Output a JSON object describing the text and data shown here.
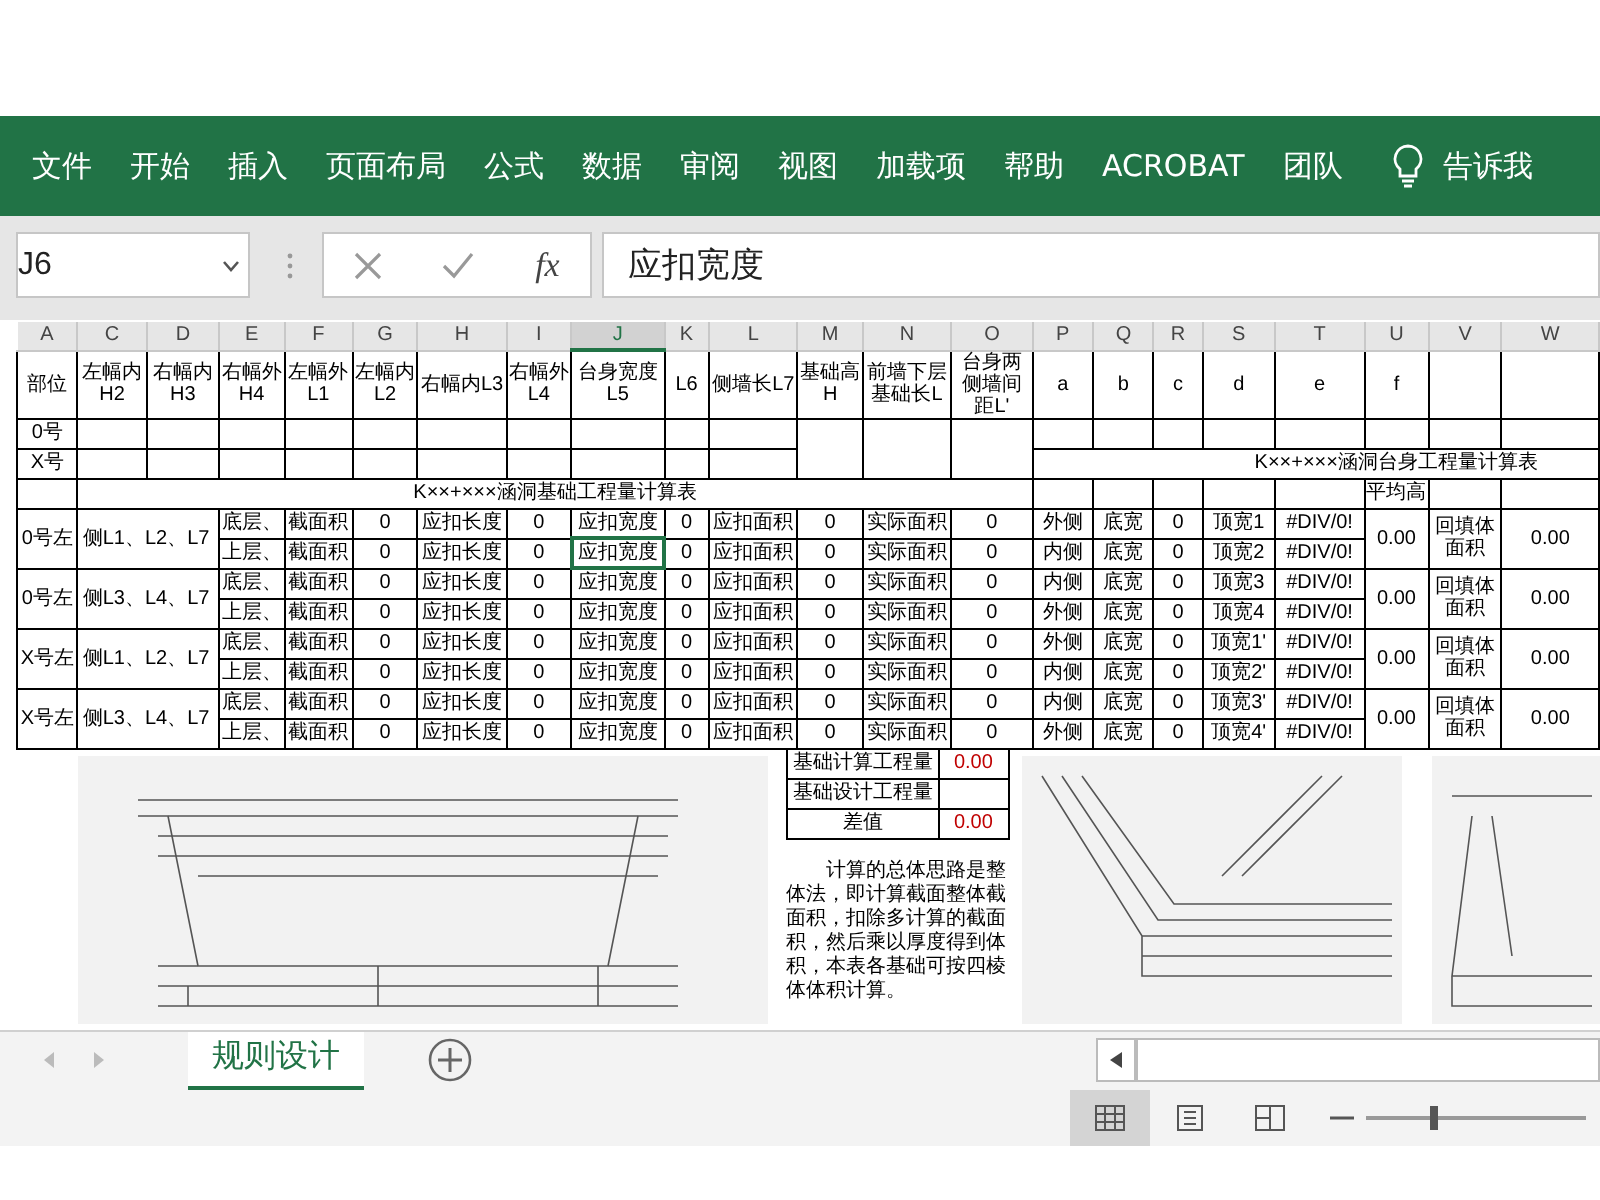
{
  "ribbon": {
    "tabs": [
      {
        "label": "文件"
      },
      {
        "label": "开始"
      },
      {
        "label": "插入"
      },
      {
        "label": "页面布局"
      },
      {
        "label": "公式"
      },
      {
        "label": "数据"
      },
      {
        "label": "审阅"
      },
      {
        "label": "视图"
      },
      {
        "label": "加载项"
      },
      {
        "label": "帮助"
      },
      {
        "label": "ACROBAT"
      },
      {
        "label": "团队"
      }
    ],
    "tell_me": "告诉我"
  },
  "formula_bar": {
    "name_box": "J6",
    "fx": "fx",
    "formula": "应扣宽度"
  },
  "sheet": {
    "columns": [
      {
        "label": "A",
        "selected": false
      },
      {
        "label": "C",
        "selected": false
      },
      {
        "label": "D",
        "selected": false
      },
      {
        "label": "E",
        "selected": false
      },
      {
        "label": "F",
        "selected": false
      },
      {
        "label": "G",
        "selected": false
      },
      {
        "label": "H",
        "selected": false
      },
      {
        "label": "I",
        "selected": false
      },
      {
        "label": "J",
        "selected": true
      },
      {
        "label": "K",
        "selected": false
      },
      {
        "label": "L",
        "selected": false
      },
      {
        "label": "M",
        "selected": false
      },
      {
        "label": "N",
        "selected": false
      },
      {
        "label": "O",
        "selected": false
      },
      {
        "label": "P",
        "selected": false
      },
      {
        "label": "Q",
        "selected": false
      },
      {
        "label": "R",
        "selected": false
      },
      {
        "label": "S",
        "selected": false
      },
      {
        "label": "T",
        "selected": false
      },
      {
        "label": "U",
        "selected": false
      },
      {
        "label": "V",
        "selected": false
      },
      {
        "label": "W",
        "selected": false
      }
    ],
    "header_row": [
      "部位",
      "左幅内H2",
      "右幅内H3",
      "右幅外H4",
      "左幅外L1",
      "左幅内L2",
      "右幅内L3",
      "右幅外L4",
      "台身宽度L5",
      "L6",
      "侧墙长L7",
      "基础高H",
      "前墙下层基础长L",
      "台身两侧墙间距L'",
      "a",
      "b",
      "c",
      "d",
      "e",
      "f"
    ],
    "label_rows": [
      "0号",
      "X号"
    ],
    "right_title": "K××+×××涵洞台身工程量计算表",
    "left_title": "K××+×××涵洞基础工程量计算表",
    "average_label": "平均高",
    "groups": [
      {
        "part": "0号左",
        "sides": "侧L1、L2、L7",
        "average": "0.00",
        "fill_label": "回填体面积",
        "total": "0.00",
        "rows": [
          {
            "layer": "底层、",
            "active": false,
            "cells": [
              "截面积",
              "0",
              "应扣长度",
              "0",
              "应扣宽度",
              "0",
              "应扣面积",
              "0",
              "实际面积",
              "0",
              "外侧",
              "底宽",
              "0",
              "顶宽1",
              "#DIV/0!"
            ]
          },
          {
            "layer": "上层、",
            "active": true,
            "cells": [
              "截面积",
              "0",
              "应扣长度",
              "0",
              "应扣宽度",
              "0",
              "应扣面积",
              "0",
              "实际面积",
              "0",
              "内侧",
              "底宽",
              "0",
              "顶宽2",
              "#DIV/0!"
            ]
          }
        ]
      },
      {
        "part": "0号左",
        "sides": "侧L3、L4、L7",
        "average": "0.00",
        "fill_label": "回填体面积",
        "total": "0.00",
        "rows": [
          {
            "layer": "底层、",
            "active": false,
            "cells": [
              "截面积",
              "0",
              "应扣长度",
              "0",
              "应扣宽度",
              "0",
              "应扣面积",
              "0",
              "实际面积",
              "0",
              "内侧",
              "底宽",
              "0",
              "顶宽3",
              "#DIV/0!"
            ]
          },
          {
            "layer": "上层、",
            "active": false,
            "cells": [
              "截面积",
              "0",
              "应扣长度",
              "0",
              "应扣宽度",
              "0",
              "应扣面积",
              "0",
              "实际面积",
              "0",
              "外侧",
              "底宽",
              "0",
              "顶宽4",
              "#DIV/0!"
            ]
          }
        ]
      },
      {
        "part": "X号左",
        "sides": "侧L1、L2、L7",
        "average": "0.00",
        "fill_label": "回填体面积",
        "total": "0.00",
        "rows": [
          {
            "layer": "底层、",
            "active": false,
            "cells": [
              "截面积",
              "0",
              "应扣长度",
              "0",
              "应扣宽度",
              "0",
              "应扣面积",
              "0",
              "实际面积",
              "0",
              "外侧",
              "底宽",
              "0",
              "顶宽1'",
              "#DIV/0!"
            ]
          },
          {
            "layer": "上层、",
            "active": false,
            "cells": [
              "截面积",
              "0",
              "应扣长度",
              "0",
              "应扣宽度",
              "0",
              "应扣面积",
              "0",
              "实际面积",
              "0",
              "内侧",
              "底宽",
              "0",
              "顶宽2'",
              "#DIV/0!"
            ]
          }
        ]
      },
      {
        "part": "X号左",
        "sides": "侧L3、L4、L7",
        "average": "0.00",
        "fill_label": "回填体面积",
        "total": "0.00",
        "rows": [
          {
            "layer": "底层、",
            "active": false,
            "cells": [
              "截面积",
              "0",
              "应扣长度",
              "0",
              "应扣宽度",
              "0",
              "应扣面积",
              "0",
              "实际面积",
              "0",
              "内侧",
              "底宽",
              "0",
              "顶宽3'",
              "#DIV/0!"
            ]
          },
          {
            "layer": "上层、",
            "active": false,
            "cells": [
              "截面积",
              "0",
              "应扣长度",
              "0",
              "应扣宽度",
              "0",
              "应扣面积",
              "0",
              "实际面积",
              "0",
              "外侧",
              "底宽",
              "0",
              "顶宽4'",
              "#DIV/0!"
            ]
          }
        ]
      }
    ],
    "summary": [
      {
        "label": "基础计算工程量",
        "value": "0.00"
      },
      {
        "label": "基础设计工程量"
      },
      {
        "label": "差值",
        "value": "0.00"
      }
    ],
    "note": "计算的总体思路是整体法，即计算截面整体截面积，扣除多计算的截面积，然后乘以厚度得到体积，本表各基础可按四棱体体积计算。"
  },
  "sheet_tabs": [
    {
      "label": "规则设计",
      "selected": true
    }
  ],
  "view_buttons": [
    {
      "kind": "normal",
      "selected": true
    },
    {
      "kind": "page_layout",
      "selected": false
    },
    {
      "kind": "page_break",
      "selected": false
    }
  ],
  "zoom": {
    "level": 0.3
  }
}
